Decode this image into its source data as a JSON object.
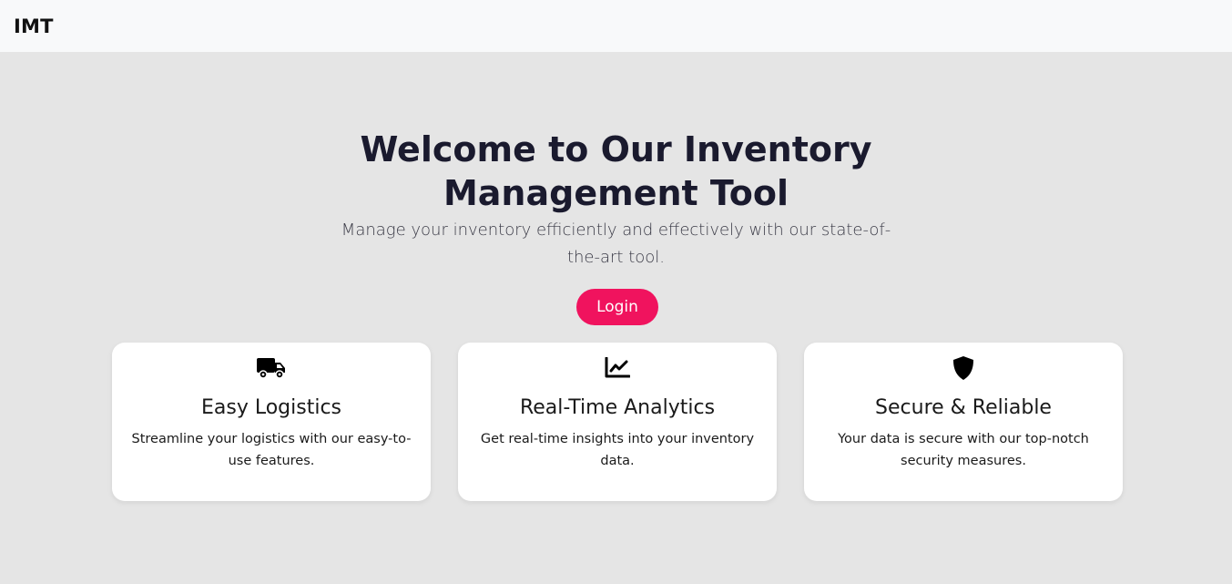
{
  "navbar": {
    "brand": "IMT"
  },
  "hero": {
    "title": "Welcome to Our Inventory Management Tool",
    "subtitle": "Manage your inventory efficiently and effectively with our state-of-the-art tool.",
    "login_label": "Login"
  },
  "features": [
    {
      "icon": "truck-icon",
      "title": "Easy Logistics",
      "description": "Streamline your logistics with our easy-to-use features."
    },
    {
      "icon": "chart-line-icon",
      "title": "Real-Time Analytics",
      "description": "Get real-time insights into your inventory data."
    },
    {
      "icon": "shield-icon",
      "title": "Secure & Reliable",
      "description": "Your data is secure with our top-notch security measures."
    }
  ],
  "colors": {
    "accent": "#f0135e",
    "background": "#e5e5e5",
    "navbar": "#f8f9fa",
    "card": "#ffffff",
    "heading": "#1a1a2e"
  }
}
